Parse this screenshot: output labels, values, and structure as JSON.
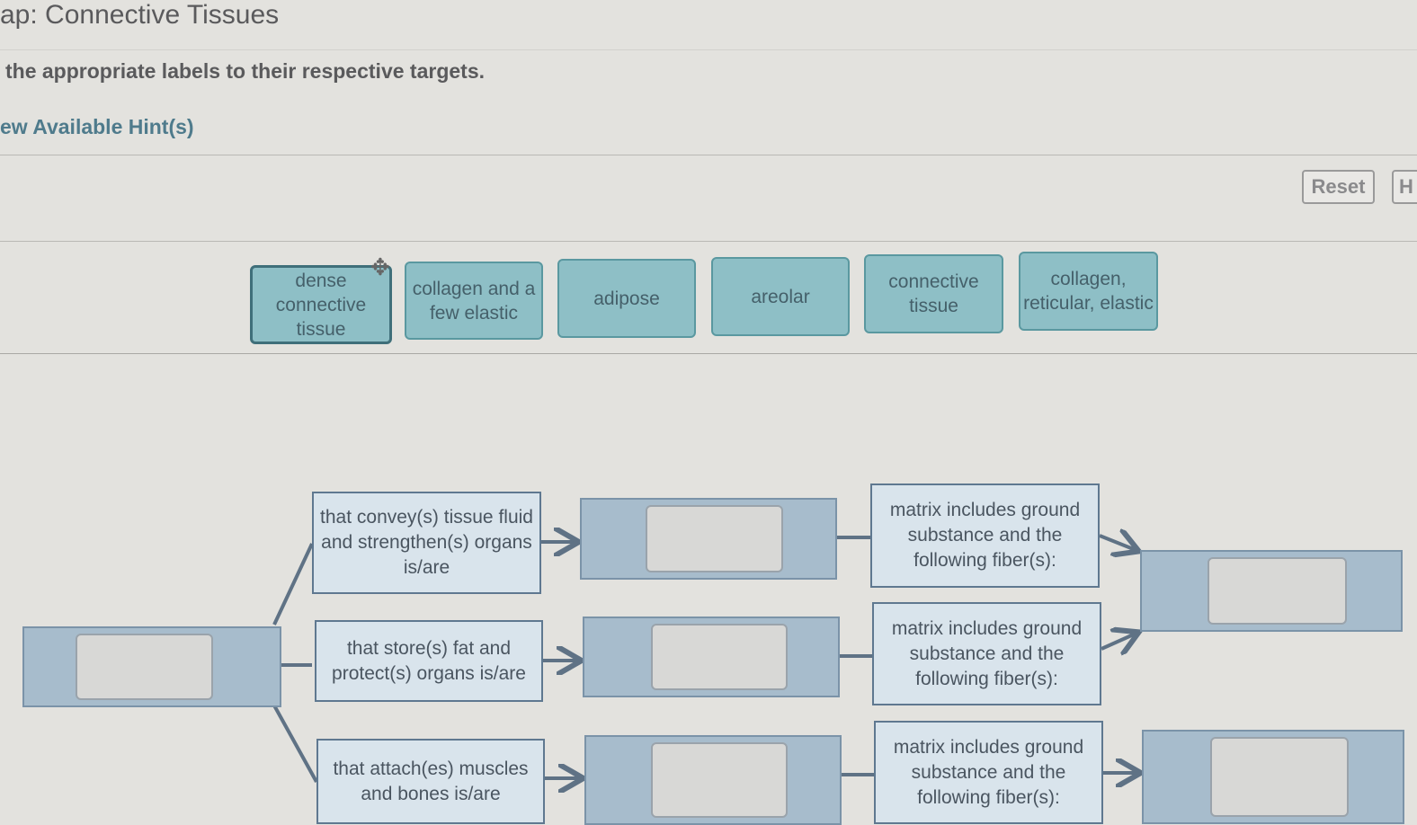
{
  "header": {
    "title": "ap: Connective Tissues",
    "instruction": "the appropriate labels to their respective targets.",
    "hint_link": "ew Available Hint(s)"
  },
  "toolbar": {
    "reset_label": "Reset",
    "help_label": "H"
  },
  "label_bank": [
    "dense connective tissue",
    "collagen and a few elastic",
    "adipose",
    "areolar",
    "connective tissue",
    "collagen, reticular, elastic"
  ],
  "concept_map": {
    "branch_texts": [
      "that convey(s) tissue fluid and strengthen(s) organs is/are",
      "that store(s) fat and protect(s) organs is/are",
      "that attach(es) muscles and bones is/are"
    ],
    "matrix_texts": [
      "matrix includes ground substance and the following fiber(s):",
      "matrix includes ground substance and the following fiber(s):",
      "matrix includes ground substance and the following fiber(s):"
    ]
  },
  "colors": {
    "chip": "#8ebfc6",
    "target": "#a7bccc",
    "text_box": "#d9e4ec",
    "background": "#e3e2de"
  }
}
